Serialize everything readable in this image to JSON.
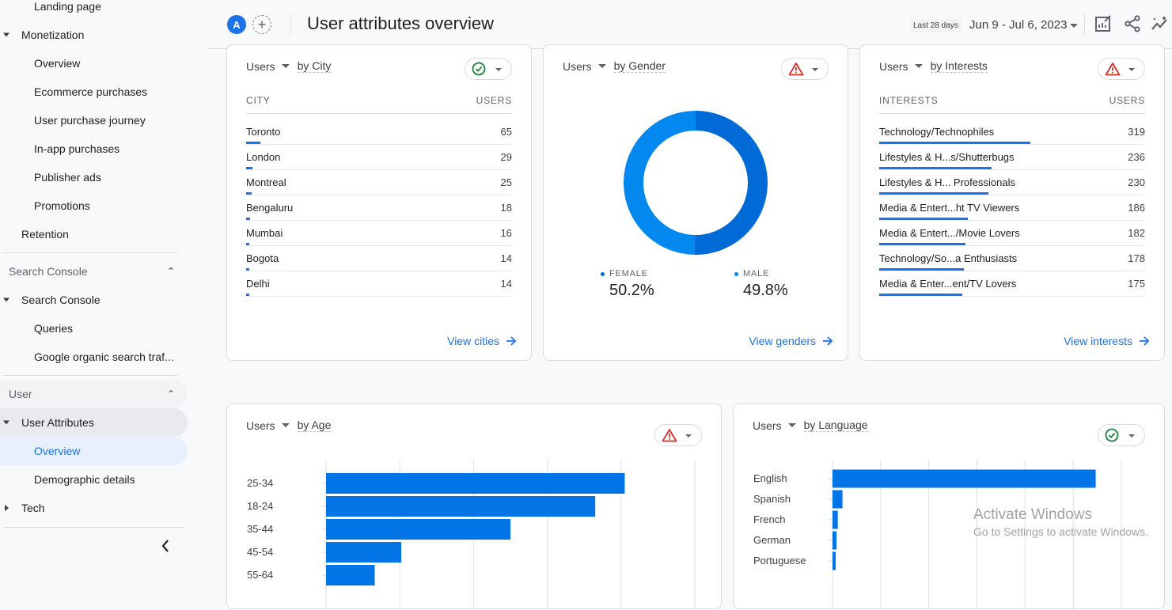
{
  "sidebar": {
    "items": [
      {
        "label": "Landing page",
        "level": 2
      },
      {
        "label": "Monetization",
        "level": 1,
        "expanded": true
      },
      {
        "label": "Overview",
        "level": 2
      },
      {
        "label": "Ecommerce purchases",
        "level": 2
      },
      {
        "label": "User purchase journey",
        "level": 2
      },
      {
        "label": "In-app purchases",
        "level": 2
      },
      {
        "label": "Publisher ads",
        "level": 2
      },
      {
        "label": "Promotions",
        "level": 2
      },
      {
        "label": "Retention",
        "level": 1
      }
    ],
    "search_console_section": "Search Console",
    "search_console_items": [
      {
        "label": "Search Console",
        "level": 1,
        "expanded": true
      },
      {
        "label": "Queries",
        "level": 2
      },
      {
        "label": "Google organic search traf...",
        "level": 2
      }
    ],
    "user_section": "User",
    "user_items": [
      {
        "label": "User Attributes",
        "level": 1,
        "expanded": true
      },
      {
        "label": "Overview",
        "level": 2,
        "active": true
      },
      {
        "label": "Demographic details",
        "level": 2
      },
      {
        "label": "Tech",
        "level": 1,
        "expanded": false
      }
    ],
    "collapse_icon": "chevron-left-icon"
  },
  "header": {
    "avatar_letter": "A",
    "add_comparison_icon": "plus-icon",
    "title": "User attributes overview",
    "date_chip": "Last 28 days",
    "date_range": "Jun 9 - Jul 6, 2023",
    "icons": [
      "customize-report-icon",
      "share-icon",
      "insights-icon"
    ]
  },
  "cards": {
    "city": {
      "metric": "Users",
      "dimension": "by City",
      "status": "ok",
      "col_label": "CITY",
      "col_value": "USERS",
      "rows": [
        {
          "label": "Toronto",
          "value": "65",
          "n": 65
        },
        {
          "label": "London",
          "value": "29",
          "n": 29
        },
        {
          "label": "Montreal",
          "value": "25",
          "n": 25
        },
        {
          "label": "Bengaluru",
          "value": "18",
          "n": 18
        },
        {
          "label": "Mumbai",
          "value": "16",
          "n": 16
        },
        {
          "label": "Bogota",
          "value": "14",
          "n": 14
        },
        {
          "label": "Delhi",
          "value": "14",
          "n": 14
        }
      ],
      "bar_max": 1200,
      "link": "View cities"
    },
    "gender": {
      "metric": "Users",
      "dimension": "by Gender",
      "status": "warning",
      "segments": [
        {
          "label": "FEMALE",
          "value": "50.2%",
          "pct": 50.2,
          "color": "#006bd6"
        },
        {
          "label": "MALE",
          "value": "49.8%",
          "pct": 49.8,
          "color": "#0288ef"
        }
      ],
      "link": "View genders"
    },
    "interests": {
      "metric": "Users",
      "dimension": "by Interests",
      "status": "warning",
      "col_label": "INTERESTS",
      "col_value": "USERS",
      "rows": [
        {
          "label": "Technology/Technophiles",
          "value": "319",
          "n": 319
        },
        {
          "label": "Lifestyles & H...s/Shutterbugs",
          "value": "236",
          "n": 236
        },
        {
          "label": "Lifestyles & H... Professionals",
          "value": "230",
          "n": 230
        },
        {
          "label": "Media & Entert...ht TV Viewers",
          "value": "186",
          "n": 186
        },
        {
          "label": "Media & Entert.../Movie Lovers",
          "value": "182",
          "n": 182
        },
        {
          "label": "Technology/So...a Enthusiasts",
          "value": "178",
          "n": 178
        },
        {
          "label": "Media & Enter...ent/TV Lovers",
          "value": "175",
          "n": 175
        }
      ],
      "bar_max": 560,
      "link": "View interests"
    },
    "age": {
      "metric": "Users",
      "dimension": "by Age",
      "status": "warning"
    },
    "language": {
      "metric": "Users",
      "dimension": "by Language",
      "status": "ok"
    }
  },
  "chart_data": [
    {
      "type": "bar",
      "orientation": "horizontal",
      "title": "Users by Age",
      "categories": [
        "25-34",
        "18-24",
        "35-44",
        "45-54",
        "55-64"
      ],
      "values": [
        405,
        365,
        250,
        102,
        66
      ],
      "xlim": [
        0,
        500
      ],
      "grid": true
    },
    {
      "type": "bar",
      "orientation": "horizontal",
      "title": "Users by Language",
      "categories": [
        "English",
        "Spanish",
        "French",
        "German",
        "Portuguese"
      ],
      "values": [
        1640,
        62,
        33,
        25,
        20
      ],
      "xlim": [
        0,
        1800
      ],
      "grid": true
    }
  ],
  "colors": {
    "accent": "#1a73e8",
    "bar": "#0275e6",
    "ok": "#188038",
    "warning": "#d93025"
  },
  "watermark": {
    "line1": "Activate Windows",
    "line2": "Go to Settings to activate Windows."
  }
}
